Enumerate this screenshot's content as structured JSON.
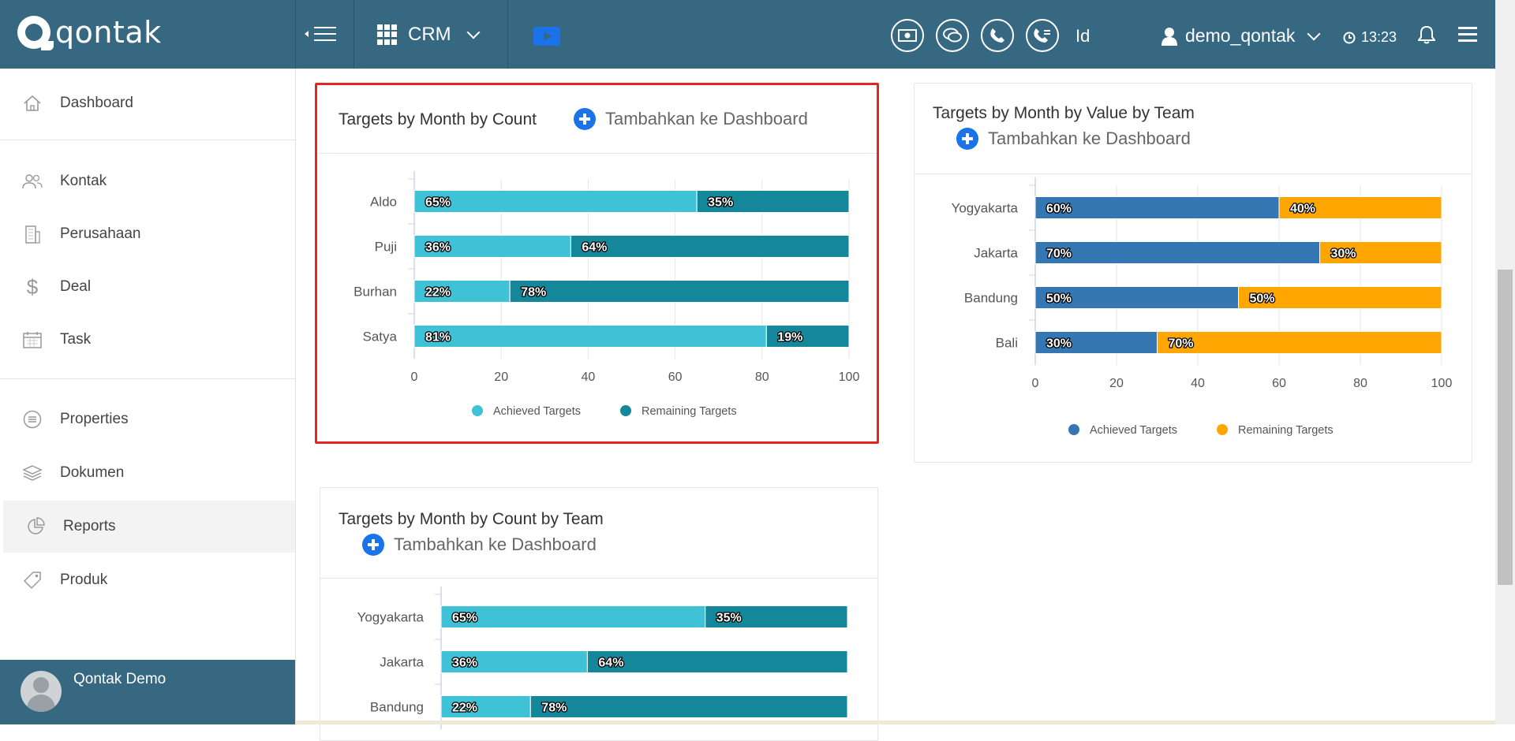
{
  "app": {
    "logo_text": "qontak",
    "module": "CRM",
    "lang": "Id",
    "user": "demo_qontak",
    "time": "13:23",
    "brand_color": "#376882"
  },
  "icons": [
    "menu-toggle-icon",
    "grid-icon",
    "youtube-icon",
    "money-icon",
    "chat-icon",
    "phone-icon",
    "call-log-icon",
    "user-icon",
    "clock-icon",
    "bell-icon",
    "hamburger-icon"
  ],
  "sidebar": {
    "items": [
      {
        "label": "Dashboard",
        "icon": "home-icon"
      },
      {
        "label": "Kontak",
        "icon": "contacts-icon"
      },
      {
        "label": "Perusahaan",
        "icon": "building-icon"
      },
      {
        "label": "Deal",
        "icon": "dollar-icon"
      },
      {
        "label": "Task",
        "icon": "calendar-icon"
      },
      {
        "label": "Properties",
        "icon": "list-icon"
      },
      {
        "label": "Dokumen",
        "icon": "layers-icon"
      },
      {
        "label": "Reports",
        "icon": "pie-icon"
      },
      {
        "label": "Produk",
        "icon": "tag-icon"
      }
    ],
    "active": "Reports",
    "footer_name": "Qontak Demo"
  },
  "add_to_dashboard": "Tambahkan ke Dashboard",
  "chart_data": [
    {
      "type": "bar",
      "stacked": true,
      "orientation": "horizontal",
      "title": "Targets by Month by Count",
      "categories": [
        "Aldo",
        "Puji",
        "Burhan",
        "Satya"
      ],
      "series": [
        {
          "name": "Achieved Targets",
          "values": [
            65,
            36,
            22,
            81
          ],
          "color": "#3fc1d6"
        },
        {
          "name": "Remaining Targets",
          "values": [
            35,
            64,
            78,
            19
          ],
          "color": "#15879a"
        }
      ],
      "xlim": [
        0,
        100
      ],
      "xticks": [
        0,
        20,
        40,
        60,
        80,
        100
      ],
      "data_label_suffix": "%",
      "legend": "bottom",
      "highlighted": true
    },
    {
      "type": "bar",
      "stacked": true,
      "orientation": "horizontal",
      "title": "Targets by Month by Value by Team",
      "categories": [
        "Yogyakarta",
        "Jakarta",
        "Bandung",
        "Bali"
      ],
      "series": [
        {
          "name": "Achieved Targets",
          "values": [
            60,
            70,
            50,
            30
          ],
          "color": "#3477b3"
        },
        {
          "name": "Remaining Targets",
          "values": [
            40,
            30,
            50,
            70
          ],
          "color": "#ffa602"
        }
      ],
      "xlim": [
        0,
        100
      ],
      "xticks": [
        0,
        20,
        40,
        60,
        80,
        100
      ],
      "data_label_suffix": "%",
      "legend": "bottom"
    },
    {
      "type": "bar",
      "stacked": true,
      "orientation": "horizontal",
      "title": "Targets by Month by Count by Team",
      "categories": [
        "Yogyakarta",
        "Jakarta",
        "Bandung"
      ],
      "series": [
        {
          "name": "Achieved Targets",
          "values": [
            65,
            36,
            22
          ],
          "color": "#3fc1d6"
        },
        {
          "name": "Remaining Targets",
          "values": [
            35,
            64,
            78
          ],
          "color": "#15879a"
        }
      ],
      "xlim": [
        0,
        100
      ],
      "data_label_suffix": "%"
    }
  ]
}
